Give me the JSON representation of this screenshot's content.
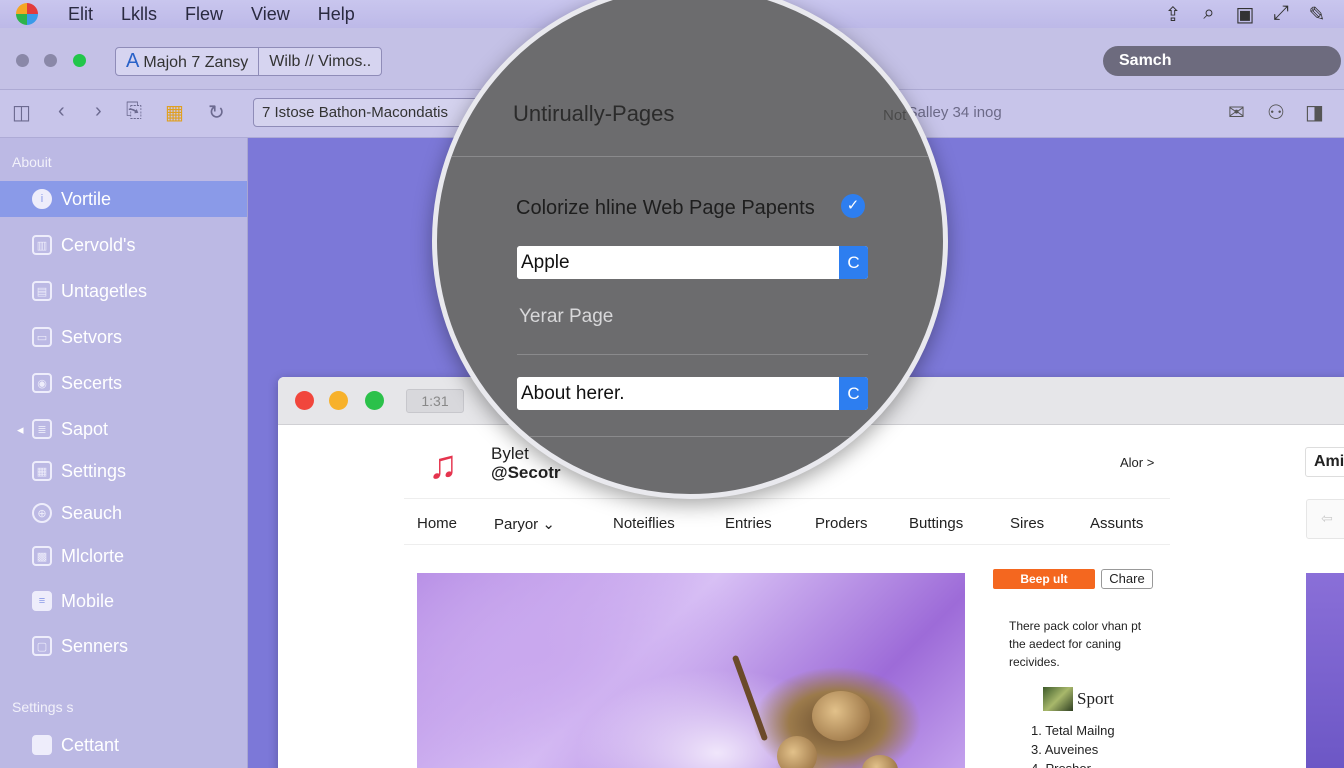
{
  "menubar": {
    "menus": [
      "Elit",
      "Lklls",
      "Flew",
      "View",
      "Help"
    ],
    "right_icons": [
      "share-icon",
      "search-add-icon",
      "image-icon",
      "edit-icon",
      "pen-icon"
    ]
  },
  "toolbar": {
    "tab1_prefix": "A",
    "tab1_label": "Majoh 7 Zansy",
    "tab2_label": "Wilb // Vimos..",
    "search_label": "Samch",
    "url": "7  Istose Bathon-Macondatis",
    "status": "Not Salley 34 inog"
  },
  "sidebar": {
    "section1": "Abouit",
    "items": [
      "Vortile",
      "Cervold's",
      "Untagetles",
      "Setvors",
      "Secerts",
      "Sapot",
      "Settings",
      "Seauch",
      "Mlclorte",
      "Mobile",
      "Senners"
    ],
    "active_index": 0,
    "section2": "Settings s",
    "footer_item": "Cettant"
  },
  "magnifier": {
    "title": "Untirually-Pages",
    "checkbox_label": "Colorize hline Web Page Papents",
    "checkbox_checked": true,
    "field1_value": "Apple",
    "field_button": "C",
    "section_label": "Yerar Page",
    "field2_value": "About herer."
  },
  "page": {
    "tab_label": "1:31",
    "brand_name": "Bylet",
    "brand_handle": "@Secotr",
    "top_right_link": "Alor >",
    "right_button": "Ami",
    "nav": [
      "Home",
      "Paryor ⌄",
      "Noteiflies",
      "Entries",
      "Proders",
      "Buttings",
      "Sires",
      "Assunts"
    ],
    "primary_button": "Beep ult",
    "share_button": "Chare",
    "promo_text": "There pack color vhan pt the aedect for caning recivides.",
    "sport_label": "Sport",
    "list": [
      "1. Tetal Mailng",
      "3. Auveines",
      "4. Preshor"
    ]
  },
  "colors": {
    "accent": "#2d7ef0",
    "sidebar_active": "#8a9ae8",
    "primary_button": "#f4671f",
    "music": "#e5344e"
  }
}
